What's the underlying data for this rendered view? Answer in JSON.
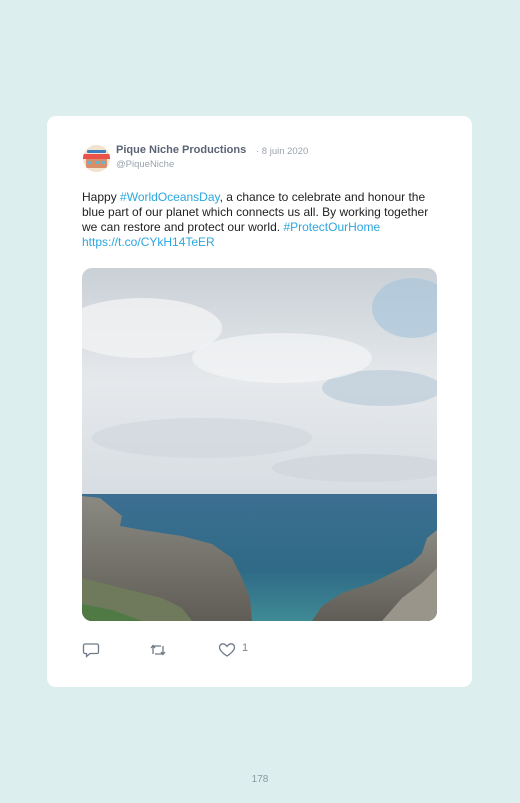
{
  "tweet": {
    "author_name": "Pique Niche Productions",
    "date": "· 8 juin 2020",
    "handle": "@PiqueNiche",
    "text": {
      "part1": "Happy ",
      "hashtag1": "#WorldOceansDay",
      "part2": ", a chance to celebrate and honour the blue part of our planet which connects us all. By working together we can restore and protect our world. ",
      "hashtag2": "#ProtectOurHome",
      "space": " ",
      "url": "https://t.co/CYkH14TeER"
    },
    "media_alt": "Coastal view of rocky cliffs and the open sea under a cloudy sky",
    "actions": {
      "reply_icon": "reply-icon",
      "retweet_icon": "retweet-icon",
      "like_icon": "heart-icon",
      "like_count": "1"
    }
  },
  "page": {
    "number": "178"
  },
  "colors": {
    "background": "#dcefee",
    "card": "#ffffff",
    "link": "#2aa7e0",
    "muted": "#9aa3ad"
  }
}
